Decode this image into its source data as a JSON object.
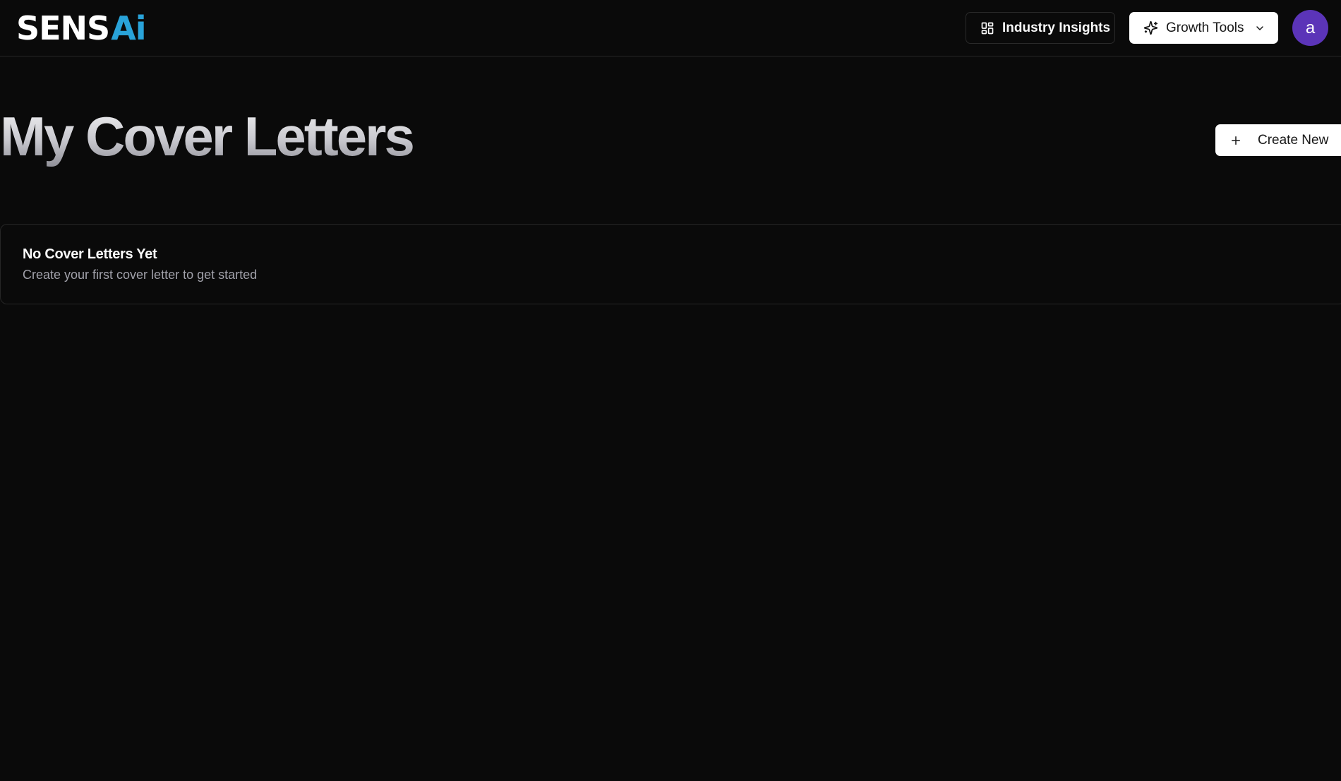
{
  "header": {
    "logo_main": "SENS",
    "logo_accent": "Ai",
    "nav": {
      "industry_insights_label": "Industry Insights",
      "growth_tools_label": "Growth Tools"
    },
    "avatar_initial": "a"
  },
  "main": {
    "page_title": "My Cover Letters",
    "create_button_label": "Create New",
    "empty_state": {
      "title": "No Cover Letters Yet",
      "description": "Create your first cover letter to get started"
    }
  },
  "icons": {
    "industry_insights": "layout-grid-icon",
    "growth_tools": "sparkles-icon",
    "growth_tools_chevron": "chevron-down-icon",
    "create": "plus-icon"
  },
  "colors": {
    "background": "#0a0a0a",
    "logo_accent": "#29a3d9",
    "avatar": "#5b34b8",
    "border": "#262626"
  }
}
